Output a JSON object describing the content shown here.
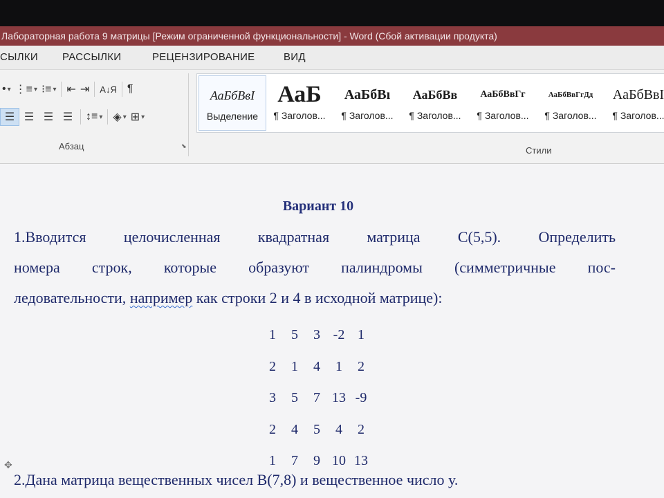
{
  "window": {
    "title": "Лабораторная работа 9 матрицы [Режим ограниченной функциональности] -  Word (Сбой активации продукта)"
  },
  "ribbon": {
    "tabs": [
      "СЫЛКИ",
      "РАССЫЛКИ",
      "РЕЦЕНЗИРОВАНИЕ",
      "ВИД"
    ],
    "paragraph_group_label": "Абзац",
    "styles_group_label": "Стили",
    "pilcrow": "¶",
    "styles": [
      {
        "sample": "АаБбВвІ",
        "name": "Выделение"
      },
      {
        "sample": "АаБ",
        "name": "¶ Заголов..."
      },
      {
        "sample": "АаБбВı",
        "name": "¶ Заголов..."
      },
      {
        "sample": "АаБбВв",
        "name": "¶ Заголов..."
      },
      {
        "sample": "АаБбВвГг",
        "name": "¶ Заголов..."
      },
      {
        "sample": "АаБбВвГгДд",
        "name": "¶ Заголов..."
      },
      {
        "sample": "АаБбВвІ",
        "name": "¶ Заголов..."
      }
    ]
  },
  "document": {
    "heading": "Вариант 10",
    "task1_lines": [
      "1.Вводится целочисленная квадратная матрица С(5,5). Определить",
      "номера строк, которые образуют палиндромы (симметричные пос-"
    ],
    "task1_line3_before": "ледовательности, ",
    "task1_line3_marked": "например",
    "task1_line3_after": " как строки 2 и 4 в исходной матрице):",
    "matrix": [
      [
        "1",
        "5",
        "3",
        "-2",
        "1"
      ],
      [
        "2",
        "1",
        "4",
        "1",
        "2"
      ],
      [
        "3",
        "5",
        "7",
        "13",
        "-9"
      ],
      [
        "2",
        "4",
        "5",
        "4",
        "2"
      ],
      [
        "1",
        "7",
        "9",
        "10",
        "13"
      ]
    ],
    "task2": "2.Дана матрица вещественных чисел В(7,8) и вещественное число у."
  }
}
